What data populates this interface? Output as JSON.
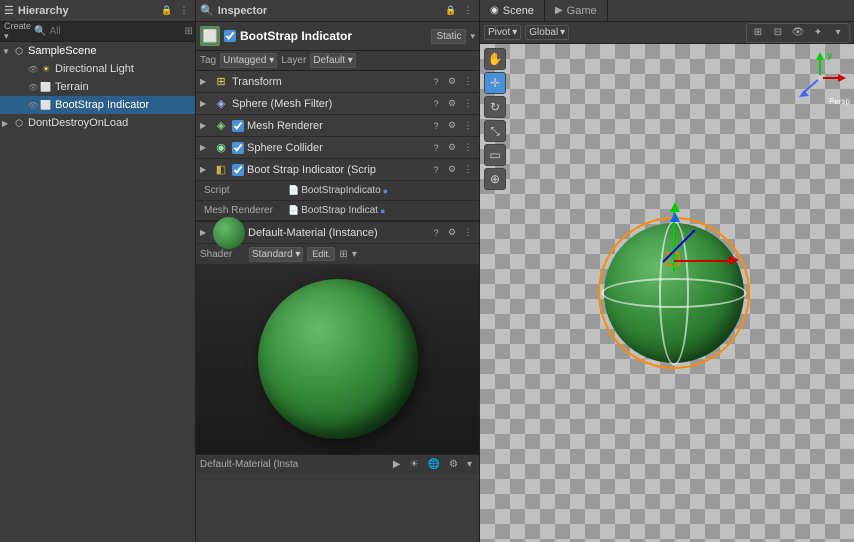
{
  "hierarchy": {
    "title": "Hierarchy",
    "search_placeholder": "All",
    "items": [
      {
        "id": "sample-scene",
        "label": "SampleScene",
        "level": 0,
        "type": "scene",
        "arrow": "▼",
        "selected": false
      },
      {
        "id": "directional-light",
        "label": "Directional Light",
        "level": 1,
        "type": "light",
        "arrow": "",
        "selected": false
      },
      {
        "id": "terrain",
        "label": "Terrain",
        "level": 1,
        "type": "cube",
        "arrow": "",
        "selected": false
      },
      {
        "id": "bootstrap-indicator",
        "label": "BootStrap Indicator",
        "level": 1,
        "type": "cube",
        "arrow": "",
        "selected": true
      },
      {
        "id": "dont-destroy-on-load",
        "label": "DontDestroyOnLoad",
        "level": 0,
        "type": "scene",
        "arrow": "▶",
        "selected": false
      }
    ]
  },
  "inspector": {
    "title": "Inspector",
    "object_name": "BootStrap Indicator",
    "static_label": "Static",
    "tag_label": "Tag",
    "tag_value": "Untagged",
    "layer_label": "Layer",
    "layer_value": "Default",
    "components": [
      {
        "id": "transform",
        "name": "Transform",
        "icon": "⊞",
        "has_check": false,
        "color": "transform"
      },
      {
        "id": "mesh-filter",
        "name": "Sphere (Mesh Filter)",
        "icon": "◈",
        "has_check": false,
        "color": "mesh"
      },
      {
        "id": "mesh-renderer",
        "name": "Mesh Renderer",
        "icon": "◈",
        "has_check": true,
        "color": "renderer"
      },
      {
        "id": "sphere-collider",
        "name": "Sphere Collider",
        "icon": "◉",
        "has_check": true,
        "color": "collider"
      },
      {
        "id": "boot-indicator-script",
        "name": "Boot Strap Indicator (Scrip",
        "icon": "◧",
        "has_check": true,
        "color": "script"
      }
    ],
    "script_label": "Script",
    "script_value": "BootStrapIndicato",
    "mesh_renderer_label": "Mesh Renderer",
    "mesh_renderer_value": "BootStrap Indicat",
    "material_name": "Default-Material (Instance)",
    "shader_label": "Shader",
    "shader_value": "Standard",
    "edit_label": "Edit.",
    "preview_name": "Default-Material (Insta"
  },
  "scene": {
    "title": "Scene",
    "game_tab": "Game",
    "pivot_label": "Pivot",
    "global_label": "Global"
  },
  "icons": {
    "lock": "🔒",
    "menu": "⋮",
    "search": "🔍",
    "eye": "👁",
    "question": "?",
    "settings": "≡"
  }
}
